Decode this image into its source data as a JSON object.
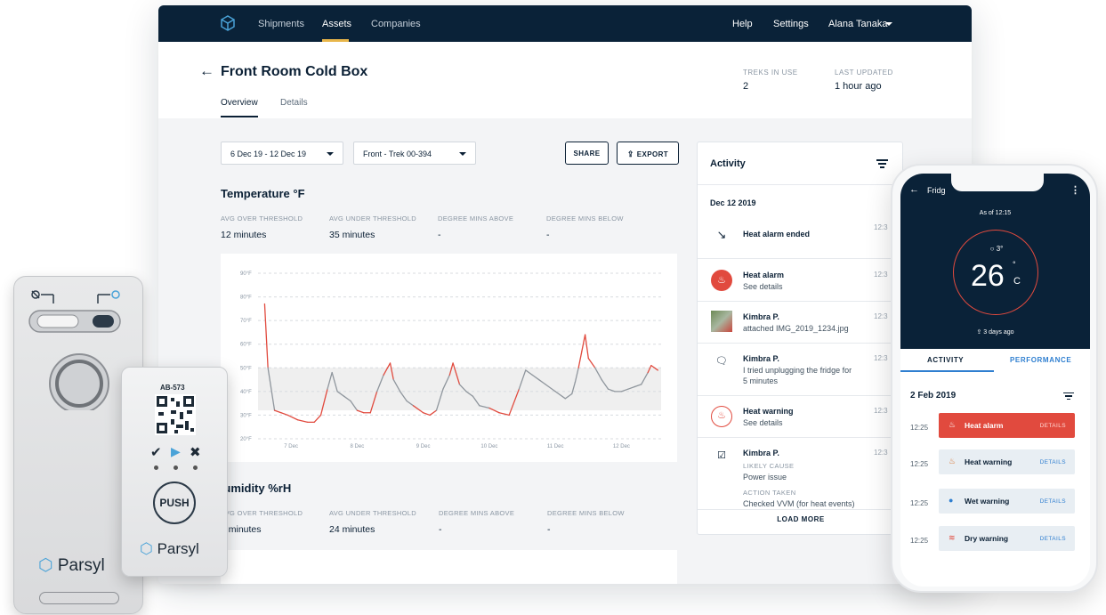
{
  "topnav": {
    "items": [
      "Shipments",
      "Assets",
      "Companies"
    ],
    "active": "Assets",
    "help": "Help",
    "settings": "Settings",
    "user": "Alana Tanaka"
  },
  "asset": {
    "title": "Front Room Cold Box",
    "tabs": [
      "Overview",
      "Details"
    ],
    "treks_label": "TREKS IN USE",
    "treks_value": "2",
    "updated_label": "LAST UPDATED",
    "updated_value": "1 hour ago"
  },
  "filters": {
    "date_range": "6 Dec 19 - 12 Dec 19",
    "trek": "Front - Trek 00-394",
    "share": "SHARE",
    "export": "EXPORT"
  },
  "temperature": {
    "title": "Temperature °F",
    "stats": [
      {
        "label": "AVG OVER THRESHOLD",
        "value": "12 minutes"
      },
      {
        "label": "AVG UNDER THRESHOLD",
        "value": "35 minutes"
      },
      {
        "label": "DEGREE MINS ABOVE",
        "value": "-"
      },
      {
        "label": "DEGREE MINS BELOW",
        "value": "-"
      }
    ]
  },
  "humidity": {
    "title": "Humidity %rH",
    "stats": [
      {
        "label": "AVG OVER THRESHOLD",
        "value": "9 minutes"
      },
      {
        "label": "AVG UNDER THRESHOLD",
        "value": "24 minutes"
      },
      {
        "label": "DEGREE MINS ABOVE",
        "value": "-"
      },
      {
        "label": "DEGREE MINS BELOW",
        "value": "-"
      }
    ]
  },
  "chart_data": {
    "type": "line",
    "title": "",
    "xlabel": "",
    "ylabel": "",
    "categories": [
      "7 Dec",
      "8 Dec",
      "9 Dec",
      "10 Dec",
      "11 Dec",
      "12 Dec"
    ],
    "y_ticks": [
      "90°F",
      "80°F",
      "70°F",
      "60°F",
      "50°F",
      "40°F",
      "30°F",
      "20°F"
    ],
    "ylim": [
      20,
      90
    ],
    "threshold_band": [
      32,
      50
    ],
    "grid": true,
    "x": [
      6.6,
      6.65,
      6.75,
      6.85,
      6.95,
      7.1,
      7.25,
      7.35,
      7.45,
      7.55,
      7.62,
      7.7,
      7.8,
      7.9,
      8.0,
      8.1,
      8.2,
      8.3,
      8.4,
      8.5,
      8.55,
      8.65,
      8.75,
      8.85,
      9.0,
      9.1,
      9.2,
      9.3,
      9.4,
      9.45,
      9.55,
      9.65,
      9.75,
      9.85,
      10.0,
      10.15,
      10.3,
      10.45,
      10.55,
      10.65,
      10.75,
      10.85,
      11.0,
      11.15,
      11.25,
      11.3,
      11.35,
      11.4,
      11.45,
      11.5,
      11.6,
      11.7,
      11.8,
      11.9,
      12.0,
      12.1,
      12.2,
      12.3,
      12.4,
      12.45,
      12.55
    ],
    "series": [
      {
        "values": [
          77,
          50,
          32,
          31,
          30,
          28,
          27,
          27,
          30,
          41,
          48,
          40,
          38,
          36,
          32,
          31,
          31,
          40,
          47,
          52,
          45,
          40,
          36,
          34,
          31,
          30,
          32,
          41,
          47,
          52,
          43,
          40,
          38,
          34,
          33,
          31,
          30,
          41,
          49,
          47,
          45,
          43,
          40,
          37,
          39,
          44,
          50,
          57,
          64,
          54,
          50,
          45,
          41,
          40,
          40,
          41,
          42,
          43,
          48,
          51,
          49
        ]
      }
    ]
  },
  "activity": {
    "title": "Activity",
    "date": "Dec 12 2019",
    "time_stub": "12:3",
    "items": [
      {
        "main": "Heat alarm ended",
        "sub": ""
      },
      {
        "main": "Heat alarm",
        "sub": "See details"
      },
      {
        "main": "Kimbra P.",
        "sub": "attached IMG_2019_1234.jpg"
      },
      {
        "main": "Kimbra P.",
        "sub": "I tried unplugging the fridge for",
        "sub_b": "5 minutes"
      },
      {
        "main": "Heat warning",
        "sub": "See details"
      },
      {
        "main": "Kimbra P.",
        "cause_label": "LIKELY CAUSE",
        "cause": "Power issue",
        "action_label": "ACTION TAKEN",
        "action": "Checked VVM (for heat events)"
      }
    ],
    "load_more": "LOAD MORE"
  },
  "devices": {
    "tag_id": "AB-573",
    "push_label": "PUSH",
    "brand": "Parsyl"
  },
  "phone": {
    "title": "Fridg",
    "as_of": "As of 12:15",
    "temp_delta": "○ 3°",
    "temp": "26",
    "temp_deg": "°",
    "temp_unit": "C",
    "updated": "3 days ago",
    "tabs": [
      "ACTIVITY",
      "PERFORMANCE"
    ],
    "date": "2 Feb 2019",
    "rows": [
      {
        "time": "12:25",
        "label": "Heat alarm",
        "details": "DETAILS",
        "icon": "fire-icon"
      },
      {
        "time": "12:25",
        "label": "Heat warning",
        "details": "DETAILS",
        "icon": "flame-icon"
      },
      {
        "time": "12:25",
        "label": "Wet warning",
        "details": "DETAILS",
        "icon": "drop-icon"
      },
      {
        "time": "12:25",
        "label": "Dry warning",
        "details": "DETAILS",
        "icon": "heat-waves-icon"
      }
    ]
  },
  "colors": {
    "navy": "#0a2238",
    "alarm_red": "#e14a3e",
    "accent_yellow": "#e8b64a",
    "link_blue": "#2f7fd0"
  }
}
